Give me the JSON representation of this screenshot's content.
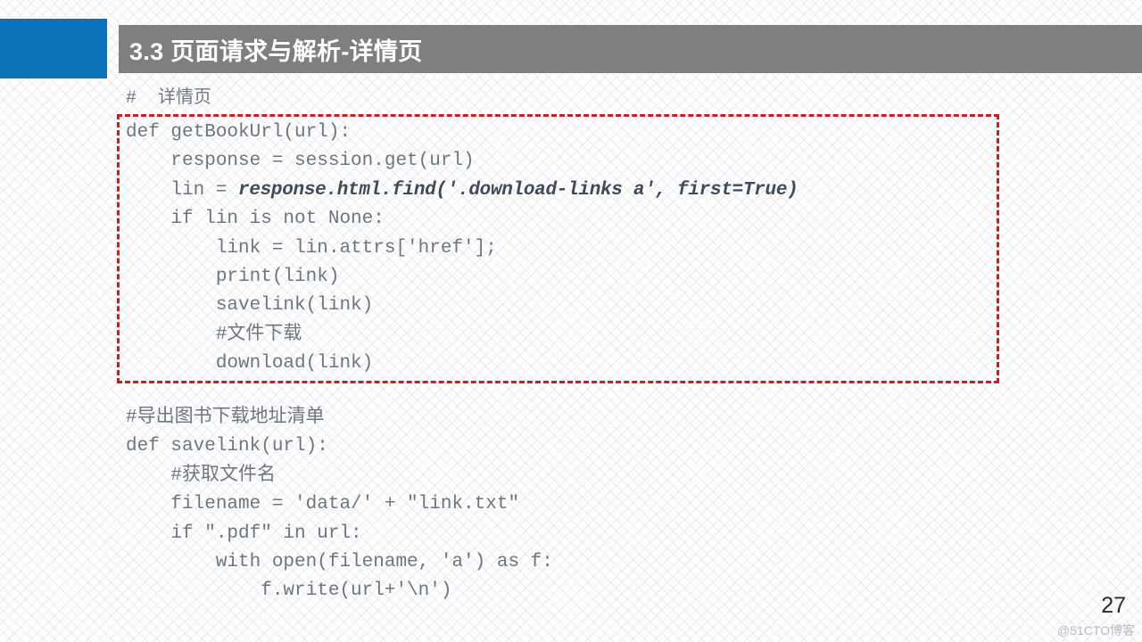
{
  "slide": {
    "header": {
      "title": "3.3 页面请求与解析-详情页",
      "accent_color": "#0b72b9",
      "band_color": "#7f7f7f",
      "title_color": "#ffffff"
    },
    "top_comment": "#  详情页",
    "highlight_box": {
      "border_color": "#c8201f",
      "border_style": "dashed"
    },
    "code_top": [
      {
        "indent": 0,
        "text": "def getBookUrl(url):"
      },
      {
        "indent": 1,
        "text": "response = session.get(url)"
      },
      {
        "indent": 1,
        "text": "lin = ",
        "highlight": "response.html.find('.download-links a', first=True)"
      },
      {
        "indent": 1,
        "text": "if lin is not None:"
      },
      {
        "indent": 2,
        "text": "link = lin.attrs['href'];"
      },
      {
        "indent": 2,
        "text": "print(link)"
      },
      {
        "indent": 2,
        "text": "savelink(link)"
      },
      {
        "indent": 2,
        "text": "#文件下载"
      },
      {
        "indent": 2,
        "text": "download(link)"
      }
    ],
    "code_bottom": [
      {
        "indent": 0,
        "text": "#导出图书下载地址清单"
      },
      {
        "indent": 0,
        "text": "def savelink(url):"
      },
      {
        "indent": 1,
        "text": "#获取文件名"
      },
      {
        "indent": 1,
        "text": "filename = 'data/' + \"link.txt\""
      },
      {
        "indent": 1,
        "text": "if \".pdf\" in url:"
      },
      {
        "indent": 2,
        "text": "with open(filename, 'a') as f:"
      },
      {
        "indent": 3,
        "text": "f.write(url+'\\n')"
      }
    ],
    "footer": {
      "page_number": "27",
      "watermark": "@51CTO博客"
    }
  }
}
